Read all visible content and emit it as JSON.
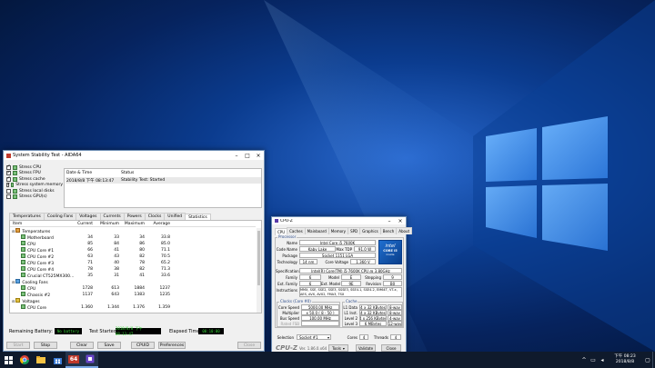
{
  "aida": {
    "title": "System Stability Test - AIDA64",
    "stress_options": [
      {
        "label": "Stress CPU",
        "checked": true
      },
      {
        "label": "Stress FPU",
        "checked": true
      },
      {
        "label": "Stress cache",
        "checked": true
      },
      {
        "label": "Stress system memory",
        "checked": true
      },
      {
        "label": "Stress local disks",
        "checked": false
      },
      {
        "label": "Stress GPU(s)",
        "checked": false
      }
    ],
    "log_header": {
      "date_time": "Date & Time",
      "status": "Status"
    },
    "log_rows": [
      {
        "date_time": "2018/8/8 下午 08:13:47",
        "status": "Stability Test: Started"
      }
    ],
    "tabs": [
      "Temperatures",
      "Cooling Fans",
      "Voltages",
      "Currents",
      "Powers",
      "Clocks",
      "Unified",
      "Statistics"
    ],
    "active_tab": "Statistics",
    "table_headers": [
      "Item",
      "Current",
      "Minimum",
      "Maximum",
      "Average"
    ],
    "rows": [
      {
        "item": "Temperatures",
        "kind": "group",
        "icon": "thermometer-icon"
      },
      {
        "item": "Motherboard",
        "current": "34",
        "minimum": "33",
        "maximum": "34",
        "average": "33.8"
      },
      {
        "item": "CPU",
        "current": "85",
        "minimum": "84",
        "maximum": "86",
        "average": "85.0"
      },
      {
        "item": "CPU Core #1",
        "current": "66",
        "minimum": "41",
        "maximum": "80",
        "average": "71.1"
      },
      {
        "item": "CPU Core #2",
        "current": "63",
        "minimum": "43",
        "maximum": "82",
        "average": "70.5"
      },
      {
        "item": "CPU Core #3",
        "current": "71",
        "minimum": "40",
        "maximum": "78",
        "average": "65.2"
      },
      {
        "item": "CPU Core #4",
        "current": "78",
        "minimum": "38",
        "maximum": "82",
        "average": "71.3"
      },
      {
        "item": "Crucial CT525MX300...",
        "current": "35",
        "minimum": "31",
        "maximum": "41",
        "average": "33.6"
      },
      {
        "item": "Cooling Fans",
        "kind": "group",
        "icon": "fan-icon"
      },
      {
        "item": "CPU",
        "current": "1728",
        "minimum": "613",
        "maximum": "1884",
        "average": "1237"
      },
      {
        "item": "Chassis #2",
        "current": "1137",
        "minimum": "643",
        "maximum": "1383",
        "average": "1235"
      },
      {
        "item": "Voltages",
        "kind": "group",
        "icon": "voltage-icon"
      },
      {
        "item": "CPU Core",
        "current": "1.360",
        "minimum": "1.344",
        "maximum": "1.376",
        "average": "1.359"
      }
    ],
    "status": {
      "battery_label": "Remaining Battery:",
      "battery_value": "No battery",
      "started_label": "Test Started:",
      "started_value": "2018/8/8 下午 08:13:47",
      "elapsed_label": "Elapsed Time:",
      "elapsed_value": "00:10:00"
    },
    "buttons": {
      "start": "Start",
      "stop": "Stop",
      "clear": "Clear",
      "save": "Save",
      "cpuid": "CPUID",
      "preferences": "Preferences",
      "close": "Close"
    }
  },
  "cpuz": {
    "title": "CPU-Z",
    "tabs": [
      "CPU",
      "Caches",
      "Mainboard",
      "Memory",
      "SPD",
      "Graphics",
      "Bench",
      "About"
    ],
    "active_tab": "CPU",
    "processor_title": "Processor",
    "name_label": "Name",
    "name": "Intel Core i5 7600K",
    "codename_label": "Code Name",
    "codename": "Kaby Lake",
    "maxtdp_label": "Max TDP",
    "maxtdp": "91.0 W",
    "package_label": "Package",
    "package": "Socket 1151 LGA",
    "tech_label": "Technology",
    "tech": "14 nm",
    "corevolt_label": "Core Voltage",
    "corevolt": "1.360 V",
    "spec_label": "Specification",
    "spec": "Intel(R) Core(TM) i5-7600K CPU @ 3.80GHz",
    "family_label": "Family",
    "family": "6",
    "model_label": "Model",
    "model": "E",
    "stepping_label": "Stepping",
    "stepping": "9",
    "extfamily_label": "Ext. Family",
    "extfamily": "6",
    "extmodel_label": "Ext. Model",
    "extmodel": "9E",
    "revision_label": "Revision",
    "revision": "B0",
    "instr_label": "Instructions",
    "instr": "MMX, SSE, SSE2, SSE3, SSSE3, SSE4.1, SSE4.2, EM64T, VT-x, AES, AVX, AVX2, FMA3, TSX",
    "clocks_title": "Clocks (Core #0)",
    "corespeed_label": "Core Speed",
    "corespeed": "5000.00 MHz",
    "mult_label": "Multiplier",
    "mult": "x 50.0 ( 8 - 50 )",
    "bus_label": "Bus Speed",
    "bus": "100.00 MHz",
    "fsb_label": "Rated FSB",
    "fsb": "",
    "cache_title": "Cache",
    "l1d_label": "L1 Data",
    "l1d": "4 x 32 KBytes",
    "l1d_way": "8-way",
    "l1i_label": "L1 Inst.",
    "l1i": "4 x 32 KBytes",
    "l1i_way": "8-way",
    "l2_label": "Level 2",
    "l2": "4 x 256 KBytes",
    "l2_way": "4-way",
    "l3_label": "Level 3",
    "l3": "6 MBytes",
    "l3_way": "12-way",
    "selection_label": "Selection",
    "selection": "Socket #1",
    "cores_label": "Cores",
    "cores": "4",
    "threads_label": "Threads",
    "threads": "4",
    "brand": "CPU-Z",
    "version": "Ver. 1.86.0.x64",
    "tools": "Tools",
    "validate": "Validate",
    "close": "Close",
    "logo_line1": "intel",
    "logo_line2": "CORE i5",
    "logo_line3": "inside"
  },
  "taskbar": {
    "icons": [
      "windows-start-icon",
      "chrome-icon",
      "file-explorer-icon",
      "store-icon",
      "aida64-icon",
      "cpu-z-icon"
    ],
    "aida_badge": "64",
    "time": "下午 08:23",
    "date": "2018/8/8"
  }
}
